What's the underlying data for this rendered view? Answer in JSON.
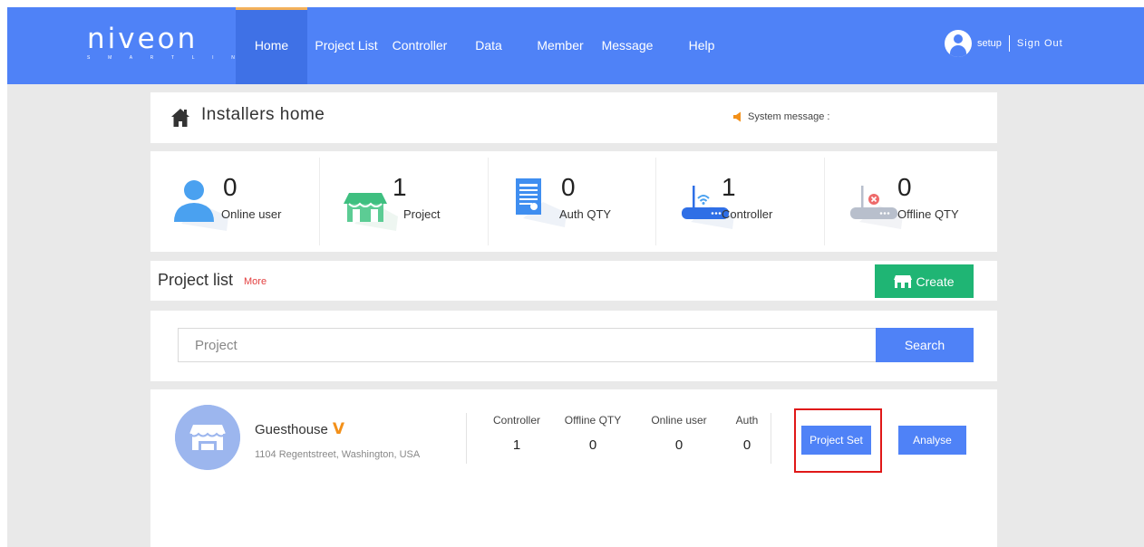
{
  "nav": {
    "logo_text": "niveon",
    "logo_subtext": "S M A R T L I N K",
    "items": [
      {
        "label": "Home",
        "active": true
      },
      {
        "label": "Project List"
      },
      {
        "label": "Controller"
      },
      {
        "label": "Data"
      },
      {
        "label": "Member"
      },
      {
        "label": "Message"
      },
      {
        "label": "Help"
      }
    ],
    "username": "setup",
    "signout": "Sign Out"
  },
  "header": {
    "title": "Installers home",
    "system_message": "System message :"
  },
  "stats": [
    {
      "value": "0",
      "label": "Online user",
      "icon": "user-icon"
    },
    {
      "value": "1",
      "label": "Project",
      "icon": "store-icon"
    },
    {
      "value": "0",
      "label": "Auth QTY",
      "icon": "document-icon"
    },
    {
      "value": "1",
      "label": "Controller",
      "icon": "router-icon"
    },
    {
      "value": "0",
      "label": "Offline QTY",
      "icon": "offline-router-icon"
    }
  ],
  "project_list": {
    "title": "Project list",
    "more": "More",
    "create": "Create"
  },
  "search": {
    "placeholder": "Project",
    "button": "Search"
  },
  "project": {
    "name": "Guesthouse",
    "verified_mark": "V",
    "address": "1104 Regentstreet, Washington, USA",
    "columns": [
      {
        "header": "Controller",
        "value": "1"
      },
      {
        "header": "Offline QTY",
        "value": "0"
      },
      {
        "header": "Online user",
        "value": "0"
      },
      {
        "header": "Auth",
        "value": "0"
      }
    ],
    "project_set": "Project Set",
    "analyse": "Analyse"
  },
  "colors": {
    "primary": "#4f82f7",
    "active_nav": "#3f71e6",
    "active_indicator": "#f3b15a",
    "create_green": "#1fb574",
    "more_red": "#e34040",
    "verified_orange": "#f39019",
    "highlight_red": "#e01818"
  }
}
